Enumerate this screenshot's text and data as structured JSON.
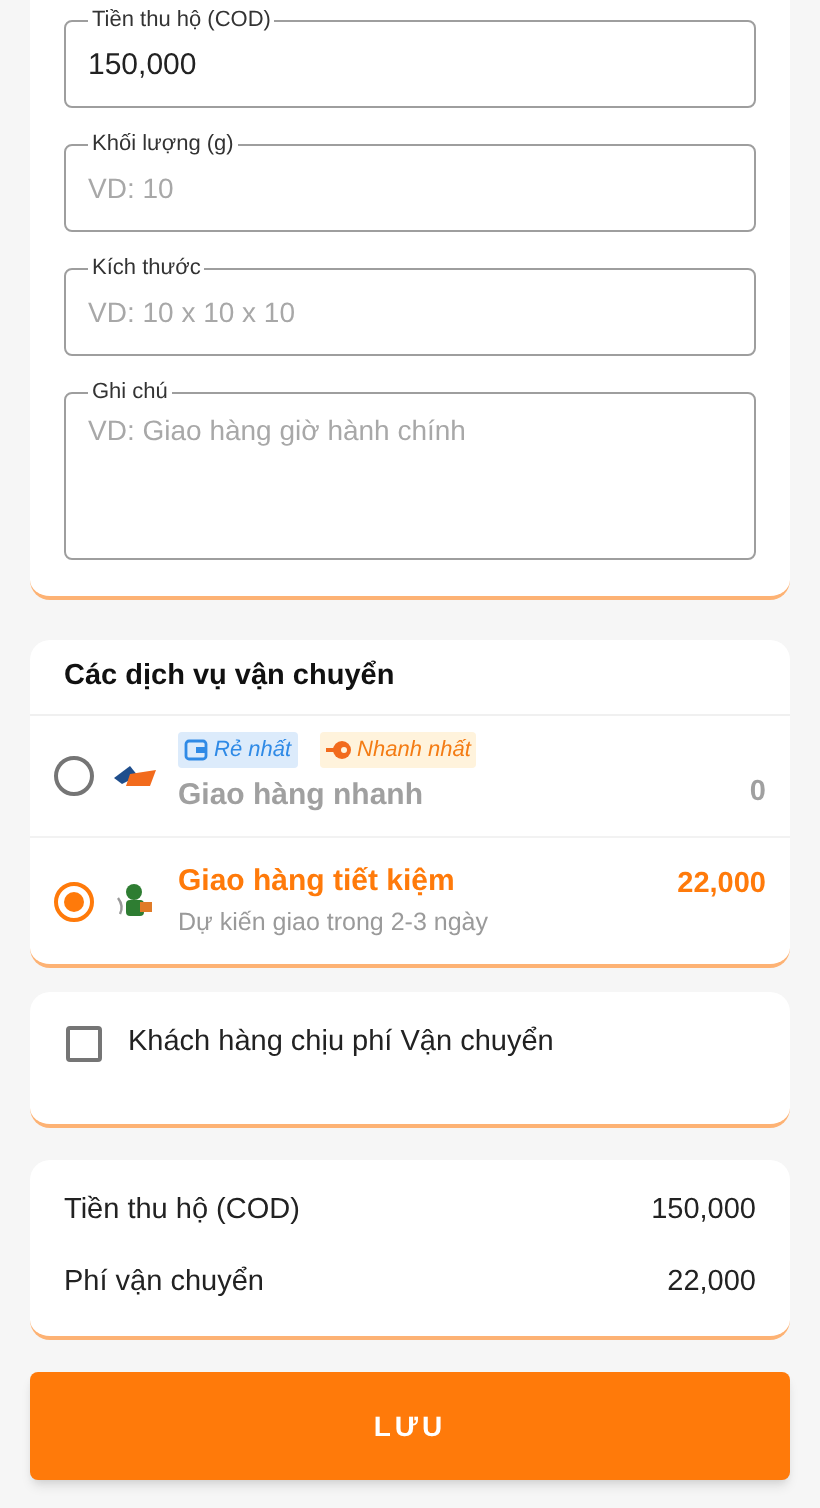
{
  "fields": [
    {
      "kind": "input",
      "label": "Tiền thu hộ (COD)",
      "value": "150,000"
    },
    {
      "kind": "input",
      "label": "Khối lượng (g)",
      "placeholder": "VD: 10"
    },
    {
      "kind": "input",
      "label": "Kích thước",
      "placeholder": "VD: 10 x 10 x 10"
    },
    {
      "kind": "textarea",
      "label": "Ghi chú",
      "placeholder": "VD: Giao hàng giờ hành chính"
    }
  ],
  "shipping": {
    "title": "Các dịch vụ vận chuyển",
    "options": [
      {
        "name": "Giao hàng nhanh",
        "price": "0",
        "selected": false,
        "badges": [
          {
            "kind": "cheapest",
            "label": "Rẻ nhất"
          },
          {
            "kind": "fastest",
            "label": "Nhanh nhất"
          }
        ]
      },
      {
        "name": "Giao hàng tiết kiệm",
        "price": "22,000",
        "selected": true,
        "note": "Dự kiến giao trong 2-3 ngày"
      }
    ]
  },
  "customer_pays_fee": {
    "label": "Khách hàng chịu phí Vận chuyển",
    "checked": false
  },
  "summary": [
    {
      "label": "Tiền thu hộ (COD)",
      "value": "150,000"
    },
    {
      "label": "Phí vận chuyển",
      "value": "22,000"
    }
  ],
  "save_button": "LƯU"
}
